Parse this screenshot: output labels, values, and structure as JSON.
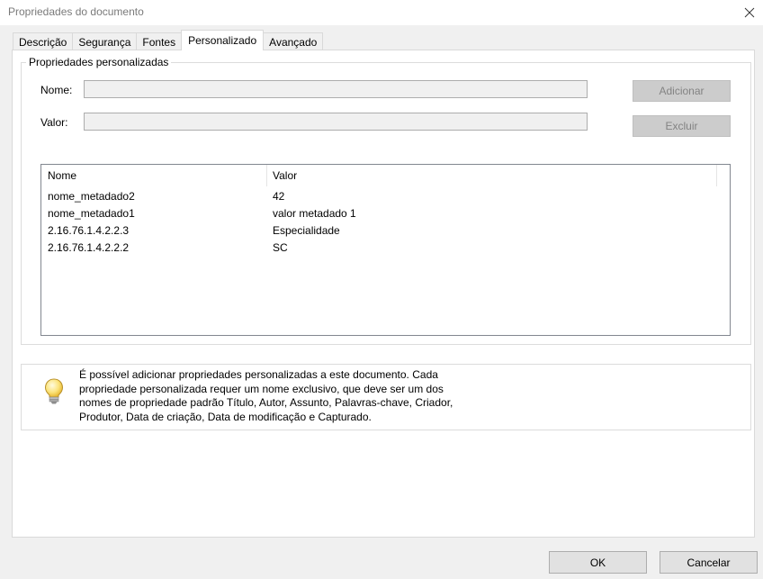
{
  "window": {
    "title": "Propriedades do documento"
  },
  "tabs": [
    {
      "label": "Descrição"
    },
    {
      "label": "Segurança"
    },
    {
      "label": "Fontes"
    },
    {
      "label": "Personalizado"
    },
    {
      "label": "Avançado"
    }
  ],
  "active_tab": "Personalizado",
  "custom_properties": {
    "group_title": "Propriedades personalizadas",
    "name_label": "Nome:",
    "name_value": "",
    "value_label": "Valor:",
    "value_value": "",
    "add_button": "Adicionar",
    "delete_button": "Excluir",
    "columns": [
      "Nome",
      "Valor"
    ],
    "rows": [
      {
        "name": "nome_metadado2",
        "value": "42"
      },
      {
        "name": "nome_metadado1",
        "value": "valor metadado 1"
      },
      {
        "name": "2.16.76.1.4.2.2.3",
        "value": "Especialidade"
      },
      {
        "name": "2.16.76.1.4.2.2.2",
        "value": "SC"
      }
    ]
  },
  "info": {
    "icon": "lightbulb-icon",
    "lines": [
      "É possível adicionar propriedades personalizadas a este documento. Cada",
      "propriedade personalizada requer um nome exclusivo, que deve ser um dos",
      "nomes de propriedade padrão Título, Autor, Assunto, Palavras-chave, Criador,",
      "Produtor, Data de criação, Data de modificação e Capturado."
    ]
  },
  "footer": {
    "ok_label": "OK",
    "cancel_label": "Cancelar"
  },
  "colors": {
    "dialog_bg": "#f0f0f0",
    "panel_bg": "#ffffff",
    "disabled_button_bg": "#cccccc",
    "disabled_text": "#838383"
  }
}
